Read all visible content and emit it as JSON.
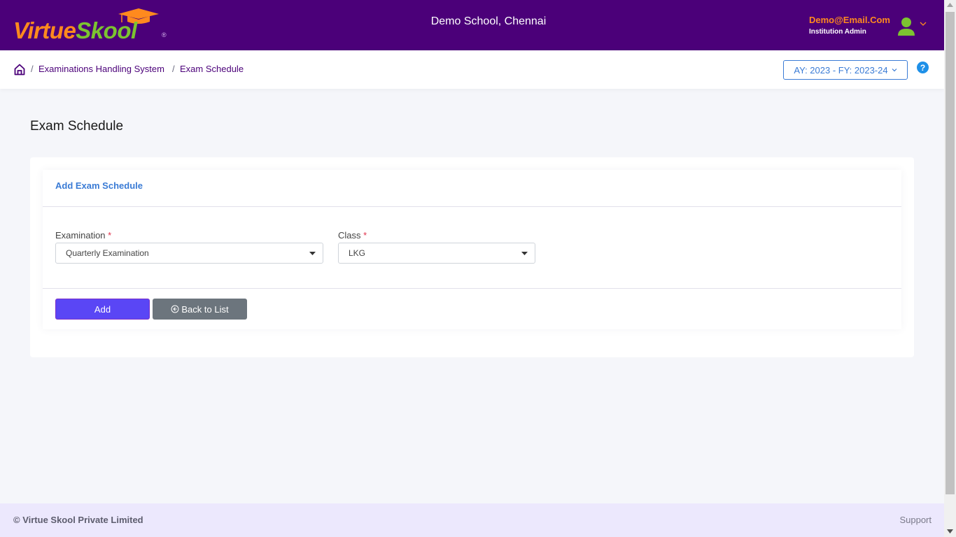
{
  "header": {
    "logo": {
      "part1": "Virtue",
      "part2": "Skool",
      "reg_mark": "®"
    },
    "school_name": "Demo School, Chennai",
    "user": {
      "email": "Demo@Email.Com",
      "role": "Institution Admin"
    }
  },
  "breadcrumb": {
    "items": [
      {
        "label": "Examinations Handling System"
      },
      {
        "label": "Exam Schedule"
      }
    ],
    "separator": "/"
  },
  "academic_year_selector": {
    "value": "AY: 2023 - FY: 2023-24"
  },
  "help": {
    "glyph": "?"
  },
  "page": {
    "title": "Exam Schedule"
  },
  "form": {
    "title": "Add Exam Schedule",
    "fields": [
      {
        "label": "Examination",
        "required_mark": "*",
        "value": "Quarterly Examination"
      },
      {
        "label": "Class",
        "required_mark": "*",
        "value": "LKG"
      }
    ],
    "buttons": {
      "add": "Add",
      "back": "Back to List"
    }
  },
  "footer": {
    "copyright": "© Virtue Skool Private Limited",
    "support": "Support"
  },
  "colors": {
    "header_bg": "#4b0079",
    "accent_orange": "#ff8a1e",
    "accent_green": "#7cc430",
    "link_blue": "#3a7bd5",
    "add_button": "#5a46f5",
    "back_button": "#6c757d",
    "footer_bg": "#ece8fd"
  }
}
